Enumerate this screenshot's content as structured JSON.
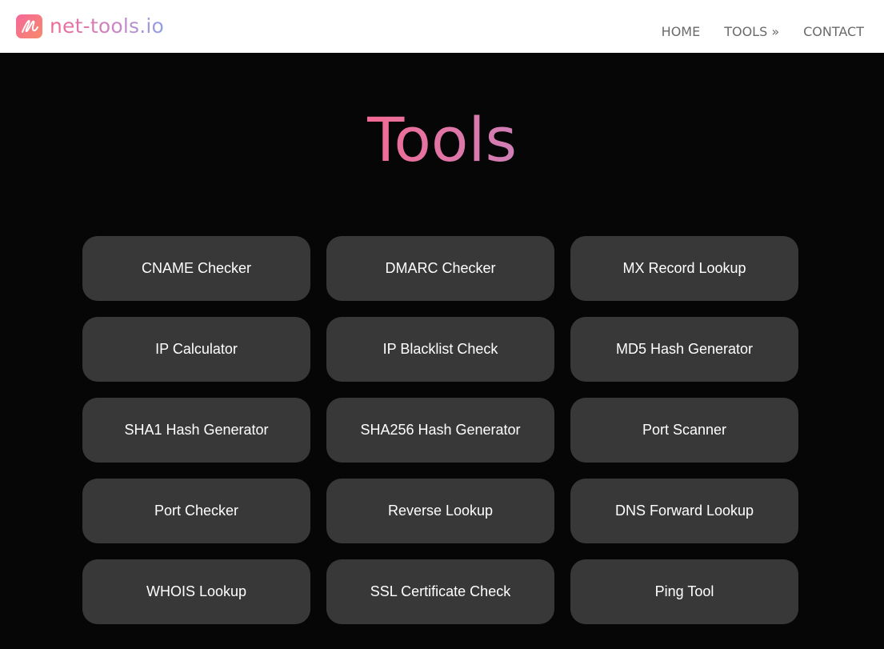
{
  "brand": {
    "name": "net-tools.io"
  },
  "nav": {
    "items": [
      {
        "label": "HOME"
      },
      {
        "label": "TOOLS »"
      },
      {
        "label": "CONTACT"
      }
    ]
  },
  "page": {
    "title": "Tools"
  },
  "tools": [
    {
      "label": "CNAME Checker"
    },
    {
      "label": "DMARC Checker"
    },
    {
      "label": "MX Record Lookup"
    },
    {
      "label": "IP Calculator"
    },
    {
      "label": "IP Blacklist Check"
    },
    {
      "label": "MD5 Hash Generator"
    },
    {
      "label": "SHA1 Hash Generator"
    },
    {
      "label": "SHA256 Hash Generator"
    },
    {
      "label": "Port Scanner"
    },
    {
      "label": "Port Checker"
    },
    {
      "label": "Reverse Lookup"
    },
    {
      "label": "DNS Forward Lookup"
    },
    {
      "label": "WHOIS Lookup"
    },
    {
      "label": "SSL Certificate Check"
    },
    {
      "label": "Ping Tool"
    }
  ],
  "colors": {
    "background": "#060606",
    "header": "#ffffff",
    "tile": "#383838",
    "tile_text": "#ffffff",
    "nav_text": "#6a6a6a",
    "accent_pink": "#f36a94",
    "accent_blue": "#8fa0e6"
  },
  "icons": {
    "logo": "brand-logo-icon"
  }
}
